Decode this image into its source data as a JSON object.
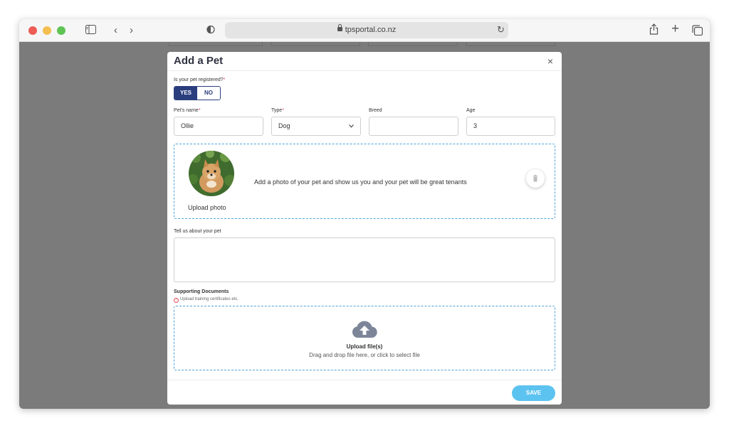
{
  "browser": {
    "url": "tpsportal.co.nz"
  },
  "modal": {
    "title": "Add a Pet",
    "close": "×"
  },
  "registered": {
    "label": "Is your pet registered?",
    "required_mark": "*",
    "options": [
      "YES",
      "NO"
    ],
    "selected": "YES"
  },
  "fields": {
    "name": {
      "label": "Pet's name",
      "required_mark": "*",
      "value": "Ollie"
    },
    "type": {
      "label": "Type",
      "required_mark": "*",
      "value": "Dog"
    },
    "breed": {
      "label": "Breed",
      "value": ""
    },
    "age": {
      "label": "Age",
      "value": "3"
    }
  },
  "photo": {
    "upload_label": "Upload photo",
    "message": "Add a photo of your pet and show us you and your pet will be great tenants"
  },
  "about": {
    "label": "Tell us about your pet",
    "value": ""
  },
  "documents": {
    "title": "Supporting Documents",
    "hint": "Upload training certificates etc.",
    "upload_title": "Upload file(s)",
    "upload_sub": "Drag and drop file here, or click to select file"
  },
  "footer": {
    "save_label": "SAVE"
  },
  "colors": {
    "primary": "#2a3e7e",
    "save": "#5cc3f0",
    "dashed_border": "#4ea3d9",
    "required": "#e04a5f"
  }
}
